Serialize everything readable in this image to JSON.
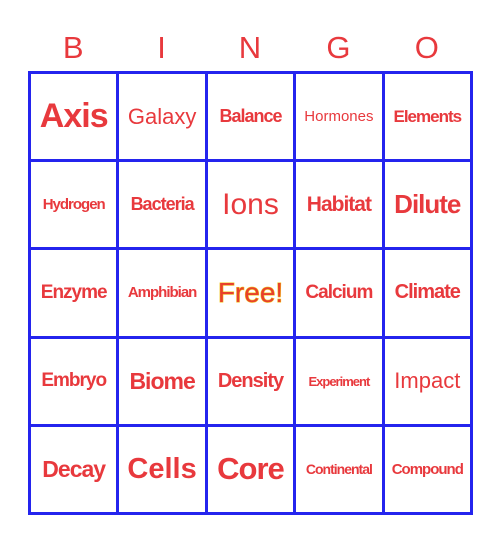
{
  "header": {
    "letters": [
      "B",
      "I",
      "N",
      "G",
      "O"
    ]
  },
  "colors": {
    "text": "#e8393d",
    "grid": "#2424ee",
    "free_outline": "#f0c419"
  },
  "board": {
    "rows": [
      [
        "Axis",
        "Galaxy",
        "Balance",
        "Hormones",
        "Elements"
      ],
      [
        "Hydrogen",
        "Bacteria",
        "Ions",
        "Habitat",
        "Dilute"
      ],
      [
        "Enzyme",
        "Amphibian",
        "Free!",
        "Calcium",
        "Climate"
      ],
      [
        "Embryo",
        "Biome",
        "Density",
        "Experiment",
        "Impact"
      ],
      [
        "Decay",
        "Cells",
        "Core",
        "Continental",
        "Compound"
      ]
    ],
    "free_space": {
      "row": 2,
      "col": 2,
      "label": "Free!"
    }
  }
}
